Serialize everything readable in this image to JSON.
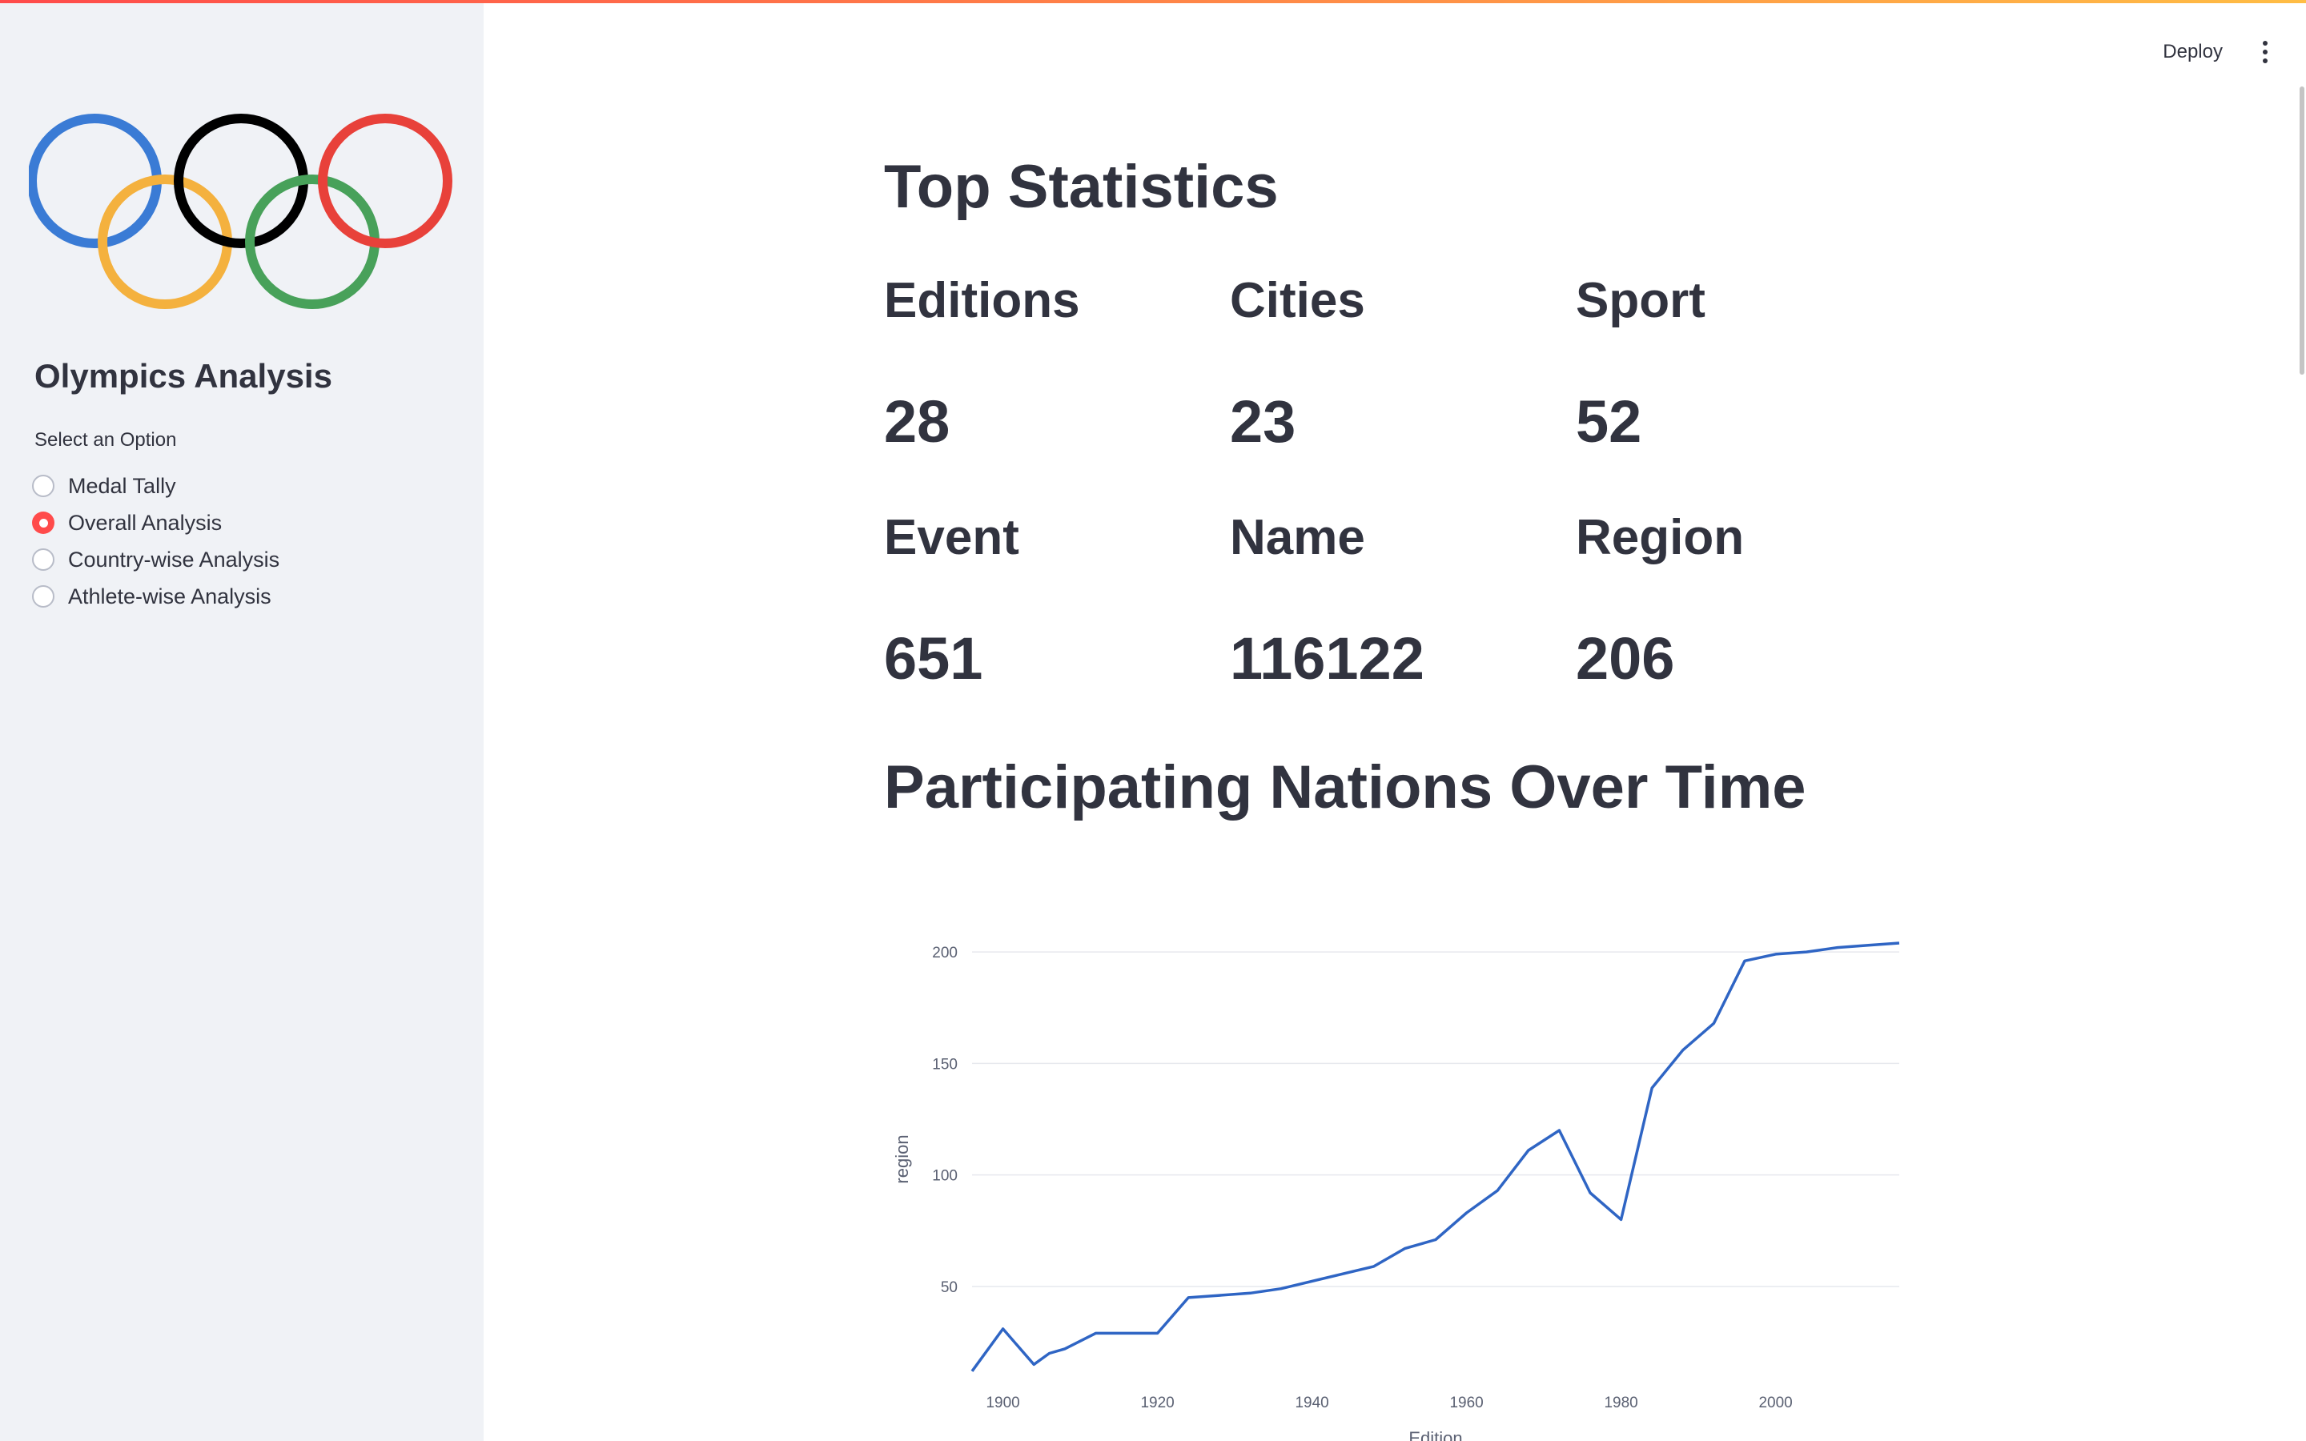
{
  "sidebar": {
    "logo": {
      "name": "olympic-rings",
      "ring_colors": [
        "#3a7bd5",
        "#000000",
        "#e8413a",
        "#f4b13e",
        "#48a15a"
      ]
    },
    "title": "Olympics Analysis",
    "radio_label": "Select an Option",
    "options": [
      {
        "label": "Medal Tally",
        "selected": false
      },
      {
        "label": "Overall Analysis",
        "selected": true
      },
      {
        "label": "Country-wise Analysis",
        "selected": false
      },
      {
        "label": "Athlete-wise Analysis",
        "selected": false
      }
    ]
  },
  "toolbar": {
    "deploy_label": "Deploy",
    "menu_icon": "kebab-menu-icon"
  },
  "main": {
    "title": "Top Statistics",
    "stats": [
      {
        "label": "Editions",
        "value": "28"
      },
      {
        "label": "Cities",
        "value": "23"
      },
      {
        "label": "Sport",
        "value": "52"
      },
      {
        "label": "Event",
        "value": "651"
      },
      {
        "label": "Name",
        "value": "116122"
      },
      {
        "label": "Region",
        "value": "206"
      }
    ],
    "section_title": "Participating Nations Over Time"
  },
  "colors": {
    "accent": "#ff4b4b",
    "line": "#2f65c4",
    "sidebar_bg": "#f0f2f6",
    "text": "#31333f"
  },
  "chart_data": {
    "type": "line",
    "xlabel": "Edition",
    "ylabel": "region",
    "x_ticks": [
      1900,
      1920,
      1940,
      1960,
      1980,
      2000
    ],
    "y_ticks": [
      50,
      100,
      150,
      200
    ],
    "xlim": [
      1896,
      2016
    ],
    "ylim": [
      13,
      204
    ],
    "grid": true,
    "series": [
      {
        "x": [
          1896,
          1900,
          1904,
          1906,
          1908,
          1912,
          1920,
          1924,
          1928,
          1932,
          1936,
          1948,
          1952,
          1956,
          1960,
          1964,
          1968,
          1972,
          1976,
          1980,
          1984,
          1988,
          1992,
          1996,
          2000,
          2004,
          2008,
          2012,
          2016
        ],
        "y": [
          12,
          31,
          15,
          20,
          22,
          29,
          29,
          45,
          46,
          47,
          49,
          59,
          67,
          71,
          83,
          93,
          111,
          120,
          92,
          80,
          139,
          156,
          168,
          196,
          199,
          200,
          202,
          203,
          204
        ]
      }
    ]
  }
}
